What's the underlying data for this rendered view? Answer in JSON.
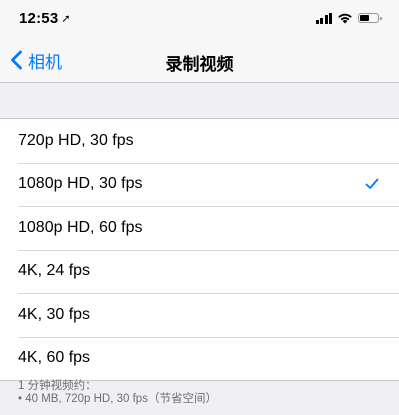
{
  "status_bar": {
    "time": "12:53",
    "location_icon": "location-arrow-icon",
    "signal_icon": "cellular-signal-icon",
    "wifi_icon": "wifi-icon",
    "battery_icon": "battery-icon"
  },
  "nav": {
    "back_label": "相机",
    "back_icon": "chevron-left-icon",
    "title": "录制视频"
  },
  "options": [
    {
      "label": "720p HD, 30 fps",
      "selected": false
    },
    {
      "label": "1080p HD, 30 fps",
      "selected": true
    },
    {
      "label": "1080p HD, 60 fps",
      "selected": false
    },
    {
      "label": "4K, 24 fps",
      "selected": false
    },
    {
      "label": "4K, 30 fps",
      "selected": false
    },
    {
      "label": "4K, 60 fps",
      "selected": false
    }
  ],
  "footer": {
    "heading": "1 分钟视频约：",
    "line1": "• 40 MB, 720p HD, 30 fps（节省空间）"
  },
  "colors": {
    "accent": "#007aff",
    "background": "#efeff4"
  }
}
